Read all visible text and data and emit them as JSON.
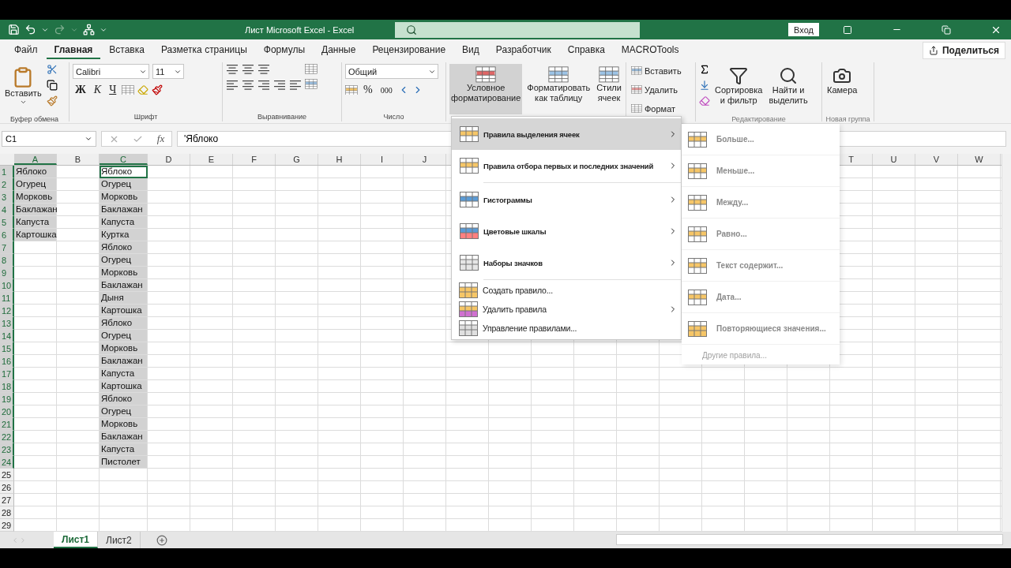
{
  "title_bar": {
    "title": "Лист Microsoft Excel  -  Excel",
    "sign_in": "Вход"
  },
  "tabs": [
    {
      "label": "Файл",
      "selected": false
    },
    {
      "label": "Главная",
      "selected": true
    },
    {
      "label": "Вставка",
      "selected": false
    },
    {
      "label": "Разметка страницы",
      "selected": false
    },
    {
      "label": "Формулы",
      "selected": false
    },
    {
      "label": "Данные",
      "selected": false
    },
    {
      "label": "Рецензирование",
      "selected": false
    },
    {
      "label": "Вид",
      "selected": false
    },
    {
      "label": "Разработчик",
      "selected": false
    },
    {
      "label": "Справка",
      "selected": false
    },
    {
      "label": "MACROTools",
      "selected": false
    }
  ],
  "share": "Поделиться",
  "ribbon": {
    "clipboard": {
      "paste": "Вставить",
      "label": "Буфер обмена"
    },
    "font": {
      "name": "Calibri",
      "size": "11",
      "bold": "Ж",
      "italic": "К",
      "underline": "Ч",
      "label": "Шрифт"
    },
    "alignment": {
      "label": "Выравнивание"
    },
    "number": {
      "format": "Общий",
      "percent": "%",
      "thousands": "000",
      "label": "Число"
    },
    "styles": [
      {
        "lines": [
          "Условное",
          "форматирование"
        ],
        "selected": true
      },
      {
        "lines": [
          "Форматировать",
          "как таблицу"
        ],
        "selected": false
      },
      {
        "lines": [
          "Стили",
          "ячеек"
        ],
        "selected": false
      }
    ],
    "cells": [
      "Вставить",
      "Удалить",
      "Формат"
    ],
    "editing": {
      "sort": [
        "Сортировка",
        "и фильтр"
      ],
      "find": [
        "Найти и",
        "выделить"
      ],
      "label": "Редактирование"
    },
    "new_group": {
      "camera": "Камера",
      "label": "Новая группа"
    }
  },
  "formula_bar": {
    "name_box": "C1",
    "function_label": "fx",
    "formula": "'Яблоко"
  },
  "grid": {
    "columns": [
      {
        "label": "A",
        "selected": true
      },
      {
        "label": "B",
        "selected": false
      },
      {
        "label": "C",
        "selected": true
      },
      {
        "label": "D",
        "selected": false
      },
      {
        "label": "E",
        "selected": false
      },
      {
        "label": "F",
        "selected": false
      },
      {
        "label": "G",
        "selected": false
      },
      {
        "label": "H",
        "selected": false
      },
      {
        "label": "I",
        "selected": false
      },
      {
        "label": "J",
        "selected": false
      }
    ],
    "columns_right": [
      {
        "label": "T",
        "selected": false
      },
      {
        "label": "U",
        "selected": false
      },
      {
        "label": "V",
        "selected": false
      },
      {
        "label": "W",
        "selected": false
      }
    ],
    "rows": [
      {
        "number": "1",
        "selected": true,
        "cells": [
          {
            "text": "Яблоко",
            "selected": true,
            "active": false
          },
          null,
          {
            "text": "Яблоко",
            "selected": true,
            "active": true
          }
        ]
      },
      {
        "number": "2",
        "selected": true,
        "cells": [
          {
            "text": "Огурец",
            "selected": true,
            "active": false
          },
          null,
          {
            "text": "Огурец",
            "selected": true,
            "active": false
          }
        ]
      },
      {
        "number": "3",
        "selected": true,
        "cells": [
          {
            "text": "Морковь",
            "selected": true,
            "active": false
          },
          null,
          {
            "text": "Морковь",
            "selected": true,
            "active": false
          }
        ]
      },
      {
        "number": "4",
        "selected": true,
        "cells": [
          {
            "text": "Баклажан",
            "selected": true,
            "active": false
          },
          null,
          {
            "text": "Баклажан",
            "selected": true,
            "active": false
          }
        ]
      },
      {
        "number": "5",
        "selected": true,
        "cells": [
          {
            "text": "Капуста",
            "selected": true,
            "active": false
          },
          null,
          {
            "text": "Капуста",
            "selected": true,
            "active": false
          }
        ]
      },
      {
        "number": "6",
        "selected": true,
        "cells": [
          {
            "text": "Картошка",
            "selected": true,
            "active": false
          },
          null,
          {
            "text": "Куртка",
            "selected": true,
            "active": false
          }
        ]
      },
      {
        "number": "7",
        "selected": true,
        "cells": [
          null,
          null,
          {
            "text": "Яблоко",
            "selected": true,
            "active": false
          }
        ]
      },
      {
        "number": "8",
        "selected": true,
        "cells": [
          null,
          null,
          {
            "text": "Огурец",
            "selected": true,
            "active": false
          }
        ]
      },
      {
        "number": "9",
        "selected": true,
        "cells": [
          null,
          null,
          {
            "text": "Морковь",
            "selected": true,
            "active": false
          }
        ]
      },
      {
        "number": "10",
        "selected": true,
        "cells": [
          null,
          null,
          {
            "text": "Баклажан",
            "selected": true,
            "active": false
          }
        ]
      },
      {
        "number": "11",
        "selected": true,
        "cells": [
          null,
          null,
          {
            "text": "Дыня",
            "selected": true,
            "active": false
          }
        ]
      },
      {
        "number": "12",
        "selected": true,
        "cells": [
          null,
          null,
          {
            "text": "Картошка",
            "selected": true,
            "active": false
          }
        ]
      },
      {
        "number": "13",
        "selected": true,
        "cells": [
          null,
          null,
          {
            "text": "Яблоко",
            "selected": true,
            "active": false
          }
        ]
      },
      {
        "number": "14",
        "selected": true,
        "cells": [
          null,
          null,
          {
            "text": "Огурец",
            "selected": true,
            "active": false
          }
        ]
      },
      {
        "number": "15",
        "selected": true,
        "cells": [
          null,
          null,
          {
            "text": "Морковь",
            "selected": true,
            "active": false
          }
        ]
      },
      {
        "number": "16",
        "selected": true,
        "cells": [
          null,
          null,
          {
            "text": "Баклажан",
            "selected": true,
            "active": false
          }
        ]
      },
      {
        "number": "17",
        "selected": true,
        "cells": [
          null,
          null,
          {
            "text": "Капуста",
            "selected": true,
            "active": false
          }
        ]
      },
      {
        "number": "18",
        "selected": true,
        "cells": [
          null,
          null,
          {
            "text": "Картошка",
            "selected": true,
            "active": false
          }
        ]
      },
      {
        "number": "19",
        "selected": true,
        "cells": [
          null,
          null,
          {
            "text": "Яблоко",
            "selected": true,
            "active": false
          }
        ]
      },
      {
        "number": "20",
        "selected": true,
        "cells": [
          null,
          null,
          {
            "text": "Огурец",
            "selected": true,
            "active": false
          }
        ]
      },
      {
        "number": "21",
        "selected": true,
        "cells": [
          null,
          null,
          {
            "text": "Морковь",
            "selected": true,
            "active": false
          }
        ]
      },
      {
        "number": "22",
        "selected": true,
        "cells": [
          null,
          null,
          {
            "text": "Баклажан",
            "selected": true,
            "active": false
          }
        ]
      },
      {
        "number": "23",
        "selected": true,
        "cells": [
          null,
          null,
          {
            "text": "Капуста",
            "selected": true,
            "active": false
          }
        ]
      },
      {
        "number": "24",
        "selected": true,
        "cells": [
          null,
          null,
          {
            "text": "Пистолет",
            "selected": true,
            "active": false
          }
        ]
      },
      {
        "number": "25",
        "selected": false
      },
      {
        "number": "26",
        "selected": false
      },
      {
        "number": "27",
        "selected": false
      },
      {
        "number": "28",
        "selected": false
      },
      {
        "number": "29",
        "selected": false
      }
    ]
  },
  "menu": {
    "items": [
      {
        "label": "Правила выделения ячеек",
        "kind": "large",
        "submenu": true,
        "selected": true
      },
      {
        "label": "Правила отбора первых и последних значений",
        "kind": "large",
        "submenu": true,
        "selected": false
      },
      {
        "label": "Гистограммы",
        "kind": "large",
        "submenu": true,
        "selected": false
      },
      {
        "label": "Цветовые шкалы",
        "kind": "large",
        "submenu": true,
        "selected": false
      },
      {
        "label": "Наборы значков",
        "kind": "large",
        "submenu": true,
        "selected": false
      },
      {
        "label": "Создать правило...",
        "kind": "small",
        "submenu": false,
        "selected": false
      },
      {
        "label": "Удалить правила",
        "kind": "small",
        "submenu": true,
        "selected": false
      },
      {
        "label": "Управление правилами...",
        "kind": "small",
        "submenu": false,
        "selected": false
      }
    ]
  },
  "submenu": {
    "items": [
      "Больше...",
      "Меньше...",
      "Между...",
      "Равно...",
      "Текст содержит...",
      "Дата...",
      "Повторяющиеся значения..."
    ],
    "more": "Другие правила..."
  },
  "sheets": [
    {
      "label": "Лист1",
      "selected": true
    },
    {
      "label": "Лист2",
      "selected": false
    }
  ]
}
